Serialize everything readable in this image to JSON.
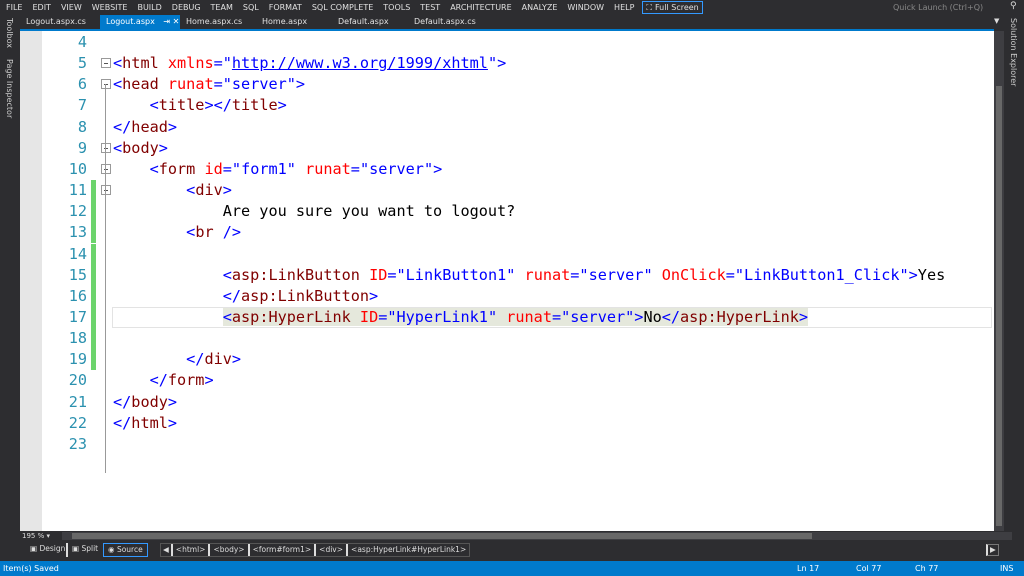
{
  "menu": [
    "FILE",
    "EDIT",
    "VIEW",
    "WEBSITE",
    "BUILD",
    "DEBUG",
    "TEAM",
    "SQL",
    "FORMAT",
    "SQL COMPLETE",
    "TOOLS",
    "TEST",
    "ARCHITECTURE",
    "ANALYZE",
    "WINDOW",
    "HELP"
  ],
  "full_screen": "Full Screen",
  "quick_launch": "Quick Launch (Ctrl+Q)",
  "tabs": [
    {
      "label": "Logout.aspx.cs"
    },
    {
      "label": "Logout.aspx",
      "active": true
    },
    {
      "label": "Home.aspx.cs"
    },
    {
      "label": "Home.aspx"
    },
    {
      "label": "Default.aspx"
    },
    {
      "label": "Default.aspx.cs"
    }
  ],
  "left_panels": [
    "Toolbox",
    "Page Inspector"
  ],
  "right_panels": [
    "Solution Explorer"
  ],
  "code": [
    {
      "n": "4",
      "t": []
    },
    {
      "n": "5",
      "fold": true,
      "t": [
        [
          "b",
          "<"
        ],
        [
          "n",
          "html"
        ],
        [
          "x",
          " "
        ],
        [
          "a",
          "xmlns"
        ],
        [
          "b",
          "=\""
        ],
        [
          "u",
          "http://www.w3.org/1999/xhtml"
        ],
        [
          "b",
          "\">"
        ]
      ]
    },
    {
      "n": "6",
      "fold": true,
      "t": [
        [
          "b",
          "<"
        ],
        [
          "n",
          "head"
        ],
        [
          "x",
          " "
        ],
        [
          "a",
          "runat"
        ],
        [
          "b",
          "=\""
        ],
        [
          "v",
          "server"
        ],
        [
          "b",
          "\">"
        ]
      ]
    },
    {
      "n": "7",
      "t": [
        [
          "x",
          "    "
        ],
        [
          "b",
          "<"
        ],
        [
          "n",
          "title"
        ],
        [
          "b",
          "></"
        ],
        [
          "n",
          "title"
        ],
        [
          "b",
          ">"
        ]
      ]
    },
    {
      "n": "8",
      "t": [
        [
          "b",
          "</"
        ],
        [
          "n",
          "head"
        ],
        [
          "b",
          ">"
        ]
      ]
    },
    {
      "n": "9",
      "fold": true,
      "t": [
        [
          "b",
          "<"
        ],
        [
          "n",
          "body"
        ],
        [
          "b",
          ">"
        ]
      ]
    },
    {
      "n": "10",
      "fold": true,
      "t": [
        [
          "x",
          "    "
        ],
        [
          "b",
          "<"
        ],
        [
          "n",
          "form"
        ],
        [
          "x",
          " "
        ],
        [
          "a",
          "id"
        ],
        [
          "b",
          "=\""
        ],
        [
          "v",
          "form1"
        ],
        [
          "b",
          "\" "
        ],
        [
          "a",
          "runat"
        ],
        [
          "b",
          "=\""
        ],
        [
          "v",
          "server"
        ],
        [
          "b",
          "\">"
        ]
      ]
    },
    {
      "n": "11",
      "fold": true,
      "chg": true,
      "t": [
        [
          "x",
          "        "
        ],
        [
          "b",
          "<"
        ],
        [
          "n",
          "div"
        ],
        [
          "b",
          ">"
        ]
      ]
    },
    {
      "n": "12",
      "chg": true,
      "t": [
        [
          "x",
          "            Are you sure you want to logout?"
        ]
      ]
    },
    {
      "n": "13",
      "chg": true,
      "t": [
        [
          "x",
          "        "
        ],
        [
          "b",
          "<"
        ],
        [
          "n",
          "br"
        ],
        [
          "x",
          " "
        ],
        [
          "b",
          "/>"
        ]
      ]
    },
    {
      "n": "14",
      "chg": true,
      "t": []
    },
    {
      "n": "15",
      "chg": true,
      "t": [
        [
          "x",
          "            "
        ],
        [
          "b",
          "<"
        ],
        [
          "n",
          "asp:LinkButton"
        ],
        [
          "x",
          " "
        ],
        [
          "a",
          "ID"
        ],
        [
          "b",
          "=\""
        ],
        [
          "v",
          "LinkButton1"
        ],
        [
          "b",
          "\" "
        ],
        [
          "a",
          "runat"
        ],
        [
          "b",
          "=\""
        ],
        [
          "v",
          "server"
        ],
        [
          "b",
          "\" "
        ],
        [
          "a",
          "OnClick"
        ],
        [
          "b",
          "=\""
        ],
        [
          "v",
          "LinkButton1_Click"
        ],
        [
          "b",
          "\">"
        ],
        [
          "x",
          "Yes"
        ]
      ]
    },
    {
      "n": "16",
      "chg": true,
      "t": [
        [
          "x",
          "            "
        ],
        [
          "b",
          "</"
        ],
        [
          "n",
          "asp:LinkButton"
        ],
        [
          "b",
          ">"
        ]
      ]
    },
    {
      "n": "17",
      "chg": true,
      "cur": true,
      "t": [
        [
          "x",
          "            "
        ],
        [
          "b",
          "<",
          1
        ],
        [
          "n",
          "asp:HyperLink",
          1
        ],
        [
          "x",
          " ",
          1
        ],
        [
          "a",
          "ID",
          1
        ],
        [
          "b",
          "=\"",
          1
        ],
        [
          "v",
          "HyperLink1",
          1
        ],
        [
          "b",
          "\" ",
          1
        ],
        [
          "a",
          "runat",
          1
        ],
        [
          "b",
          "=\"",
          1
        ],
        [
          "v",
          "server",
          1
        ],
        [
          "b",
          "\">",
          1
        ],
        [
          "x",
          "No",
          1
        ],
        [
          "b",
          "</",
          1
        ],
        [
          "n",
          "asp:HyperLink",
          1
        ],
        [
          "b",
          ">",
          1
        ]
      ]
    },
    {
      "n": "18",
      "chg": true,
      "t": []
    },
    {
      "n": "19",
      "chg": true,
      "t": [
        [
          "x",
          "        "
        ],
        [
          "b",
          "</"
        ],
        [
          "n",
          "div"
        ],
        [
          "b",
          ">"
        ]
      ]
    },
    {
      "n": "20",
      "t": [
        [
          "x",
          "    "
        ],
        [
          "b",
          "</"
        ],
        [
          "n",
          "form"
        ],
        [
          "b",
          ">"
        ]
      ]
    },
    {
      "n": "21",
      "t": [
        [
          "b",
          "</"
        ],
        [
          "n",
          "body"
        ],
        [
          "b",
          ">"
        ]
      ]
    },
    {
      "n": "22",
      "t": [
        [
          "b",
          "</"
        ],
        [
          "n",
          "html"
        ],
        [
          "b",
          ">"
        ]
      ]
    },
    {
      "n": "23",
      "t": []
    }
  ],
  "zoom_level": "195 %",
  "views": {
    "design": "Design",
    "split": "Split",
    "source": "Source"
  },
  "breadcrumbs": [
    "<html>",
    "<body>",
    "<form#form1>",
    "<div>",
    "<asp:HyperLink#HyperLink1>"
  ],
  "status": {
    "message": "Item(s) Saved",
    "line": "Ln 17",
    "col": "Col 77",
    "ch": "Ch 77",
    "mode": "INS"
  },
  "colors": {
    "accent": "#007acc",
    "tag": "#800000",
    "attr": "#ff0000",
    "value": "#0000ff",
    "line_number": "#2b91af",
    "change": "#6cd46c"
  }
}
